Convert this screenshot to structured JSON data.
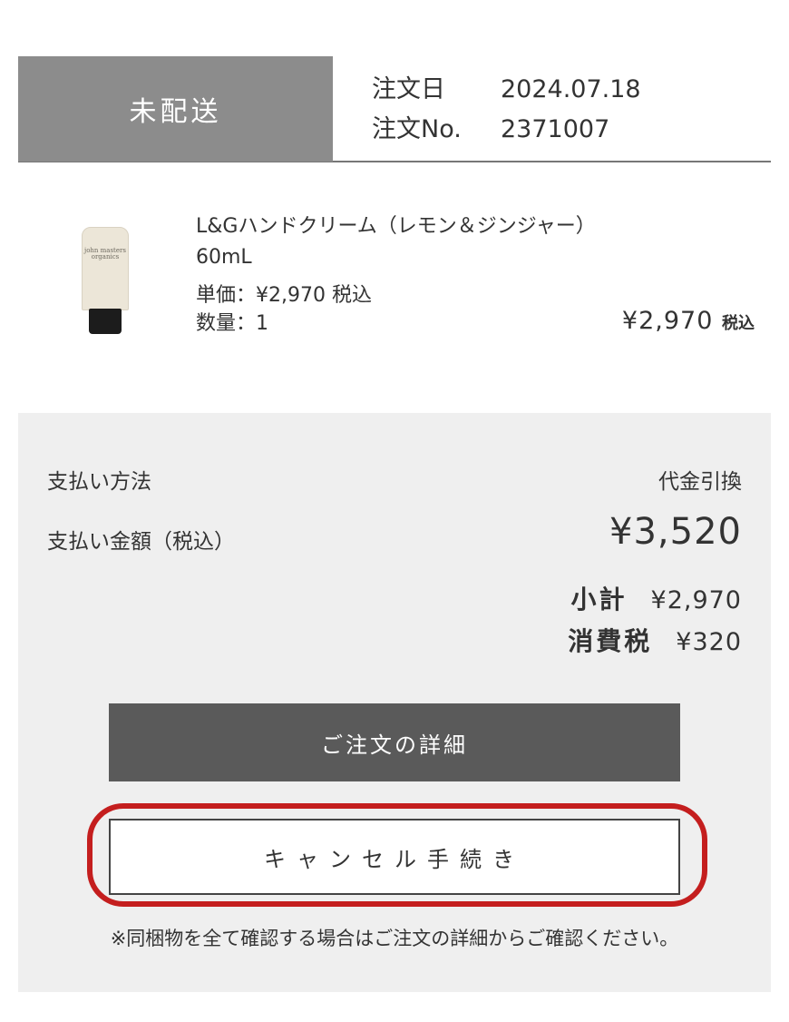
{
  "order": {
    "status": "未配送",
    "date_label": "注文日",
    "date": "2024.07.18",
    "no_label": "注文No.",
    "no": "2371007"
  },
  "product": {
    "image_brand_text": "john masters organics",
    "name": "L&Gハンドクリーム（レモン＆ジンジャー）",
    "size": "60mL",
    "unit_price": "単価：¥2,970 税込",
    "quantity": "数量：1",
    "line_total": "¥2,970",
    "line_total_tax": "税込"
  },
  "summary": {
    "payment_method_label": "支払い方法",
    "payment_method": "代金引換",
    "amount_label": "支払い金額（税込）",
    "amount": "¥3,520",
    "subtotal_label": "小計",
    "subtotal": "¥2,970",
    "tax_label": "消費税",
    "tax": "¥320"
  },
  "buttons": {
    "detail": "ご注文の詳細",
    "cancel": "キャンセル手続き"
  },
  "note": "※同梱物を全て確認する場合はご注文の詳細からご確認ください。",
  "colors": {
    "status_bg": "#8c8c8c",
    "panel_bg": "#efefef",
    "detail_button_bg": "#5a5a5a",
    "highlight": "#c41e1e"
  }
}
